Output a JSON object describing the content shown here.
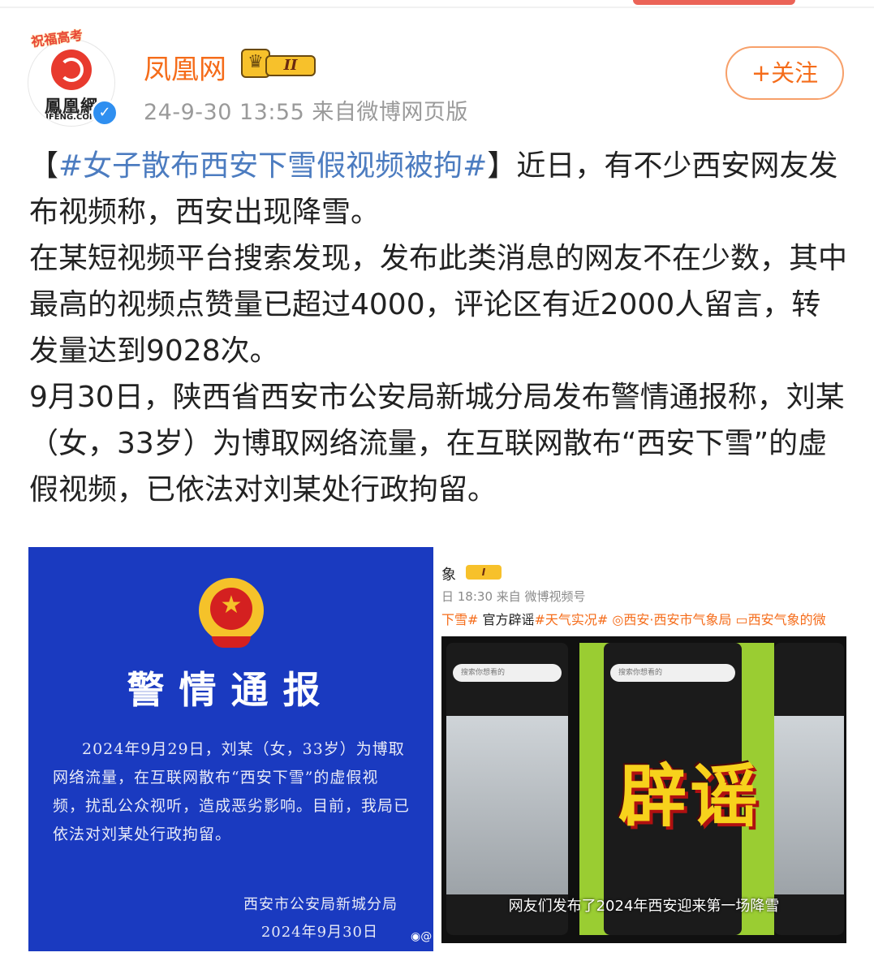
{
  "header": {
    "ribbon": "祝福高考",
    "author_name": "凤凰网",
    "avatar_logo": "鳳凰網",
    "avatar_logo_sub": "IFENG.COM",
    "level_badge": "II",
    "meta": "24-9-30 13:55  来自微博网页版",
    "follow_label": "+关注"
  },
  "post": {
    "hashtag_open": "【",
    "hashtag": "#女子散布西安下雪假视频被拘#",
    "hashtag_close": "】",
    "p1_rest": "近日，有不少西安网友发布视频称，西安出现降雪。",
    "p2": "在某短视频平台搜索发现，发布此类消息的网友不在少数，其中最高的视频点赞量已超过4000，评论区有近2000人留言，转发量达到9028次。",
    "p3": "9月30日，陕西省西安市公安局新城分局发布警情通报称，刘某（女，33岁）为博取网络流量，在互联网散布“西安下雪”的虚假视频，已依法对刘某处行政拘留。"
  },
  "image_left": {
    "title": "警情通报",
    "body": "2024年9月29日，刘某（女，33岁）为博取网络流量，在互联网散布“西安下雪”的虚假视频，扰乱公众视听，造成恶劣影响。目前，我局已依法对刘某处行政拘留。",
    "org": "西安市公安局新城分局",
    "date": "2024年9月30日"
  },
  "image_right": {
    "head1": "象",
    "badge": "I",
    "head2": "日 18:30 来自 微博视频号",
    "tags_a": "下雪#",
    "tags_b": " 官方辟谣",
    "tags_c": "#天气实况# ◎西安·西安市气象局 ▭西安气象的微",
    "search_placeholder": "搜索你想看的",
    "rumor_label": "辟谣",
    "caption": "网友们发布了2024年西安迎来第一场降雪"
  },
  "colors": {
    "accent": "#f56c1a",
    "hashtag": "#4c7cc0",
    "notice_bg": "#1a3ac0"
  }
}
